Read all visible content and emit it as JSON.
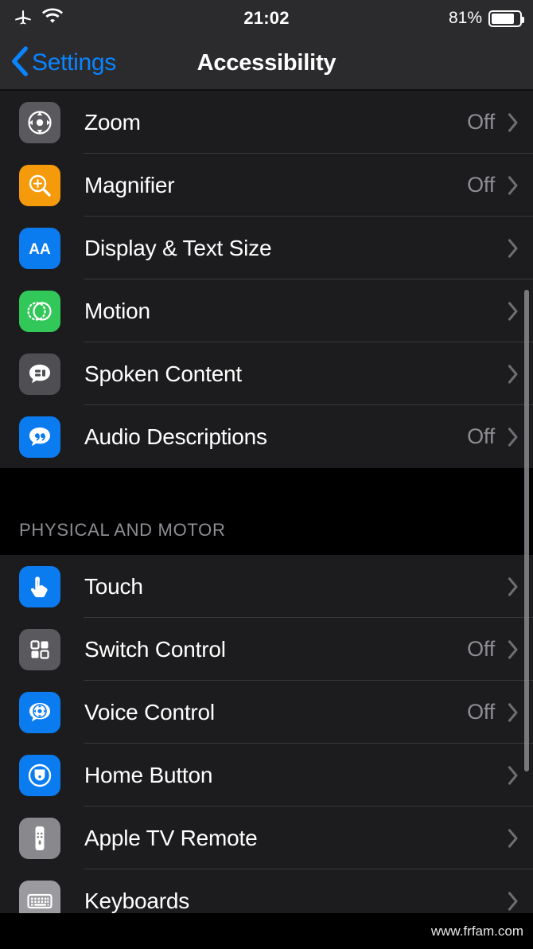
{
  "statusbar": {
    "airplane_icon": "airplane-mode-icon",
    "wifi_icon": "wifi-icon",
    "time": "21:02",
    "battery_percent": "81%",
    "battery_level": 81
  },
  "navbar": {
    "back_label": "Settings",
    "back_icon": "chevron-left-icon",
    "title": "Accessibility"
  },
  "sections": [
    {
      "header": null,
      "rows": [
        {
          "label": "Zoom",
          "value": "Off",
          "icon": "zoom-icon",
          "icon_bg": "#5a5a5e"
        },
        {
          "label": "Magnifier",
          "value": "Off",
          "icon": "magnifier-icon",
          "icon_bg": "#f59a0b"
        },
        {
          "label": "Display & Text Size",
          "value": "",
          "icon": "display-text-size-icon",
          "icon_bg": "#0a7cf0"
        },
        {
          "label": "Motion",
          "value": "",
          "icon": "motion-icon",
          "icon_bg": "#32c759"
        },
        {
          "label": "Spoken Content",
          "value": "",
          "icon": "spoken-content-icon",
          "icon_bg": "#4f4f53"
        },
        {
          "label": "Audio Descriptions",
          "value": "Off",
          "icon": "audio-descriptions-icon",
          "icon_bg": "#0a7cf0"
        }
      ]
    },
    {
      "header": "PHYSICAL AND MOTOR",
      "rows": [
        {
          "label": "Touch",
          "value": "",
          "icon": "touch-icon",
          "icon_bg": "#0a7cf0"
        },
        {
          "label": "Switch Control",
          "value": "Off",
          "icon": "switch-control-icon",
          "icon_bg": "#5a5a5e"
        },
        {
          "label": "Voice Control",
          "value": "Off",
          "icon": "voice-control-icon",
          "icon_bg": "#0a7cf0"
        },
        {
          "label": "Home Button",
          "value": "",
          "icon": "home-button-icon",
          "icon_bg": "#0a7cf0"
        },
        {
          "label": "Apple TV Remote",
          "value": "",
          "icon": "apple-tv-remote-icon",
          "icon_bg": "#88888d"
        },
        {
          "label": "Keyboards",
          "value": "",
          "icon": "keyboards-icon",
          "icon_bg": "#9a9a9f"
        }
      ]
    }
  ],
  "footer": {
    "watermark": "www.frfam.com"
  },
  "colors": {
    "accent_blue": "#0a84ff",
    "list_bg": "#1c1c1e",
    "page_bg": "#000000",
    "separator": "#39393c",
    "secondary_text": "#8d8d93",
    "navbar_bg": "#2b2b2d"
  }
}
